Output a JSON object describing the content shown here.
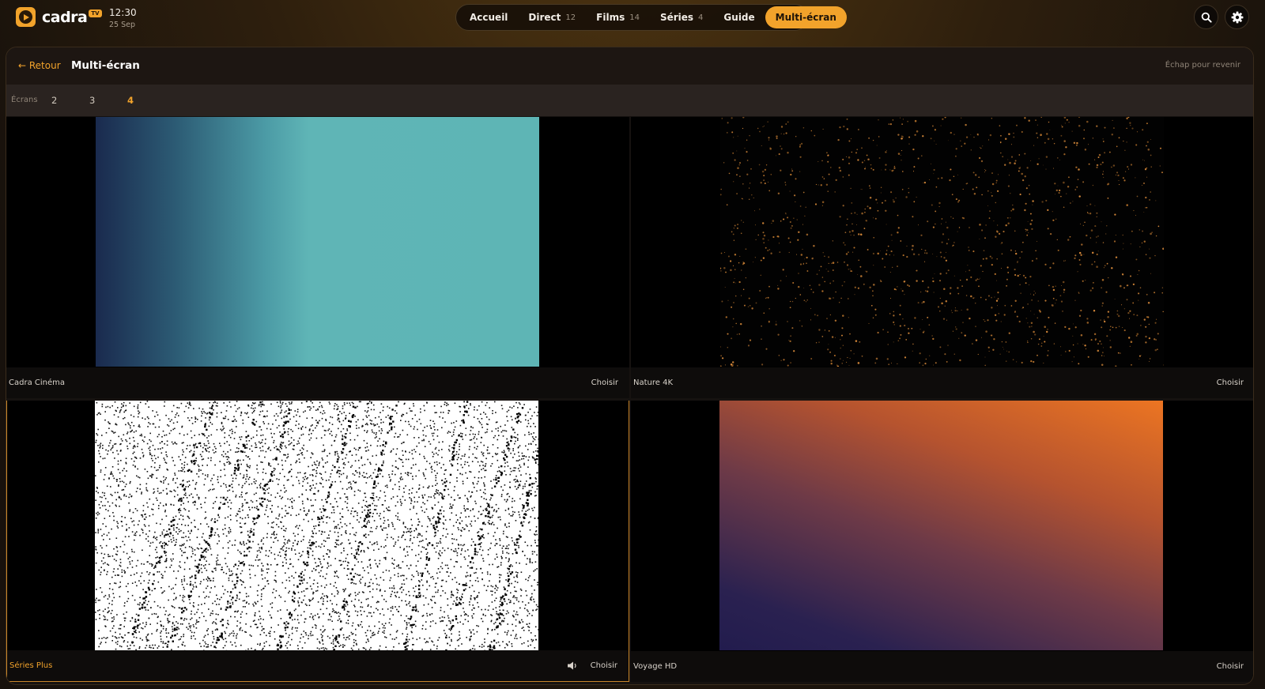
{
  "brand": {
    "name": "cadra",
    "badge": "TV"
  },
  "clock": {
    "time": "12:30",
    "date": "25 Sep"
  },
  "nav": {
    "items": [
      {
        "label": "Accueil",
        "count": ""
      },
      {
        "label": "Direct",
        "count": "12"
      },
      {
        "label": "Films",
        "count": "14"
      },
      {
        "label": "Séries",
        "count": "4"
      },
      {
        "label": "Guide",
        "count": ""
      },
      {
        "label": "Multi-écran",
        "count": "",
        "active": true
      }
    ]
  },
  "toolbar": {
    "search_icon": "search-icon",
    "settings_icon": "gear-icon"
  },
  "page": {
    "back_label": "← Retour",
    "title": "Multi-écran",
    "escape_hint": "Échap pour revenir"
  },
  "screens": {
    "label": "Écrans",
    "options": [
      "2",
      "3",
      "4"
    ],
    "selected": "4"
  },
  "tiles": [
    {
      "channel": "Cadra Cinéma",
      "choose_label": "Choisir",
      "audio": false
    },
    {
      "channel": "Nature 4K",
      "choose_label": "Choisir",
      "audio": false
    },
    {
      "channel": "Séries Plus",
      "choose_label": "Choisir",
      "audio": true
    },
    {
      "channel": "Voyage HD",
      "choose_label": "Choisir",
      "audio": false
    }
  ],
  "colors": {
    "accent": "#f2a32b",
    "panel": "#161210",
    "text": "#e8e2da"
  }
}
